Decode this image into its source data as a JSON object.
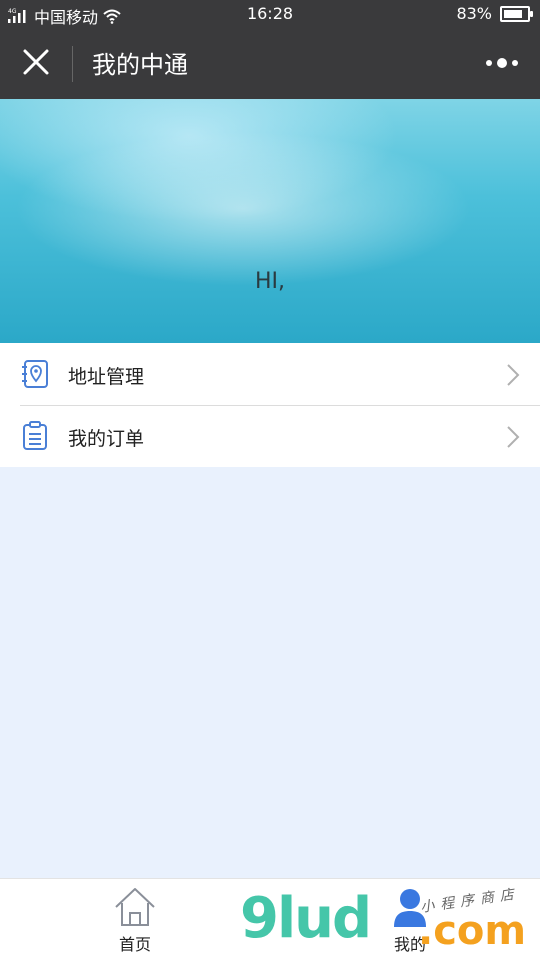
{
  "status_bar": {
    "network": "4G",
    "carrier": "中国移动",
    "time": "16:28",
    "battery_percent": "83%",
    "battery_level": 0.83
  },
  "nav": {
    "title": "我的中通"
  },
  "hero": {
    "greeting": "HI,"
  },
  "menu": {
    "items": [
      {
        "label": "地址管理",
        "icon": "address-book-icon"
      },
      {
        "label": "我的订单",
        "icon": "clipboard-list-icon"
      }
    ]
  },
  "tab_bar": {
    "tabs": [
      {
        "label": "首页",
        "icon": "home-icon"
      },
      {
        "label": "我的",
        "icon": "person-icon"
      }
    ]
  },
  "watermark": {
    "text": "9lud",
    "domain": ".com",
    "subtitle": "小程序商店"
  },
  "colors": {
    "nav_bg": "#3a3a3c",
    "page_bg": "#e9f1fd",
    "icon_blue": "#4a7fd6",
    "watermark_green": "#45c6a9",
    "watermark_orange": "#f4a11f"
  }
}
